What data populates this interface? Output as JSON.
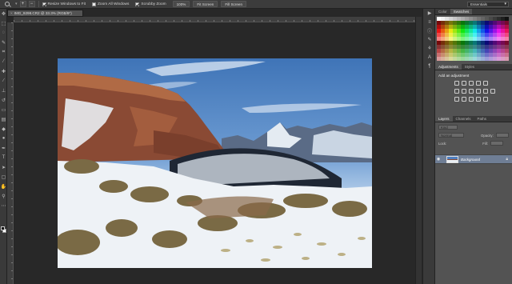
{
  "options_bar": {
    "checks": [
      {
        "label": "Resize Windows to Fit",
        "checked": true
      },
      {
        "label": "Zoom All Windows",
        "checked": false
      },
      {
        "label": "Scrubby Zoom",
        "checked": true
      }
    ],
    "buttons": [
      "100%",
      "Fit Screen",
      "Fill Screen"
    ],
    "workspace": "Essentials"
  },
  "document": {
    "tab_title": "IMG_9298.CR2 @ 33.3% (RGB/8*)",
    "close_glyph": "×"
  },
  "panels": {
    "color_tabs": [
      "Color",
      "Swatches"
    ],
    "adjustment_tabs": [
      "Adjustments",
      "Styles"
    ],
    "adjustment_title": "Add an adjustment",
    "layers_tabs": [
      "Layers",
      "Channels",
      "Paths"
    ],
    "kind_label": "Kind",
    "blend_mode": "Normal",
    "opacity_label": "Opacity:",
    "lock_label": "Lock:",
    "fill_label": "Fill:",
    "layer_name": "Background",
    "eye_icon": "eye-icon",
    "lock_icon": "lock-icon"
  },
  "colors": {
    "sky_top": "#3f74b7",
    "layer_selected": "#6f7e95",
    "panel_bg": "#535353"
  }
}
